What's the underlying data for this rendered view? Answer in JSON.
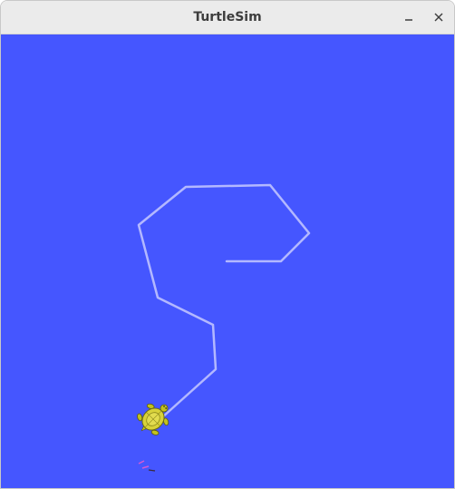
{
  "window": {
    "title": "TurtleSim",
    "controls": {
      "minimize_icon": "minimize-icon",
      "close_icon": "close-icon"
    }
  },
  "canvas": {
    "background_color": "#4556ff",
    "pen_color": "#b3b8ff",
    "turtle": {
      "icon": "turtle-icon",
      "shell_color": "#d8d23a",
      "heading": "north-east"
    }
  }
}
